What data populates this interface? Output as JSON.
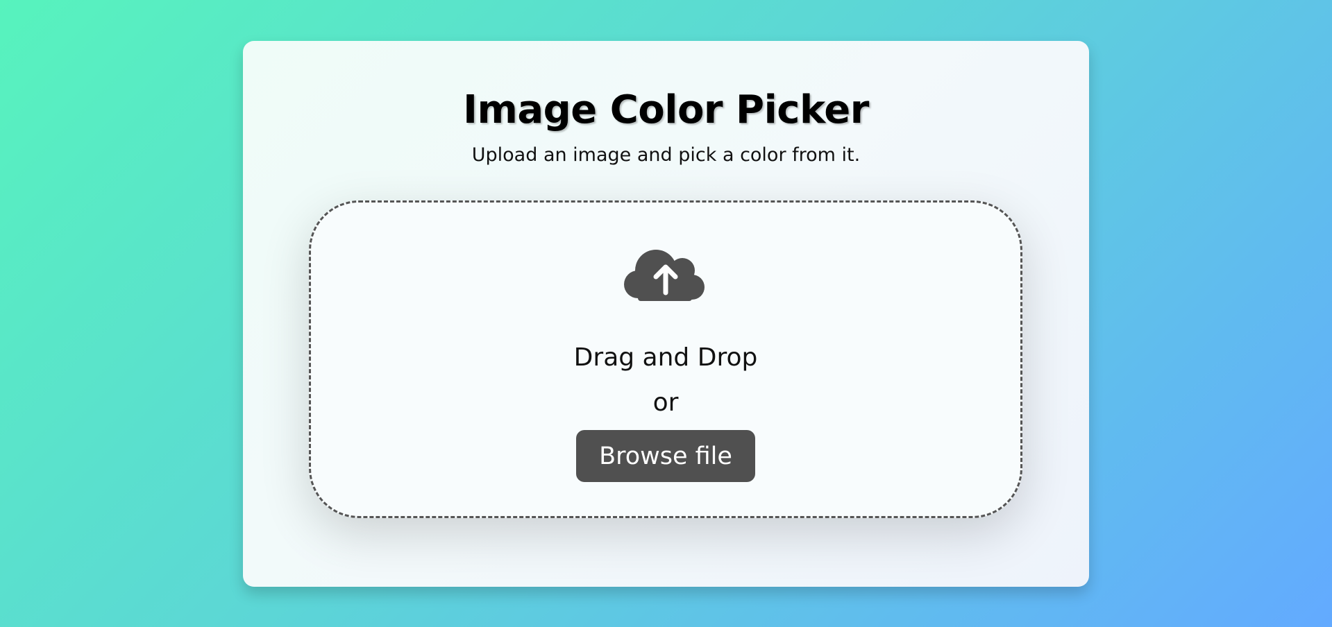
{
  "page": {
    "title": "Image Color Picker",
    "subtitle": "Upload an image and pick a color from it."
  },
  "upload": {
    "icon": "cloud-upload-icon",
    "drag_text": "Drag and Drop",
    "or_text": "or",
    "browse_label": "Browse file"
  },
  "colors": {
    "background_start": "#57f3bd",
    "background_end": "#63aaff",
    "button": "#505050",
    "icon": "#505050",
    "border": "#555555"
  }
}
